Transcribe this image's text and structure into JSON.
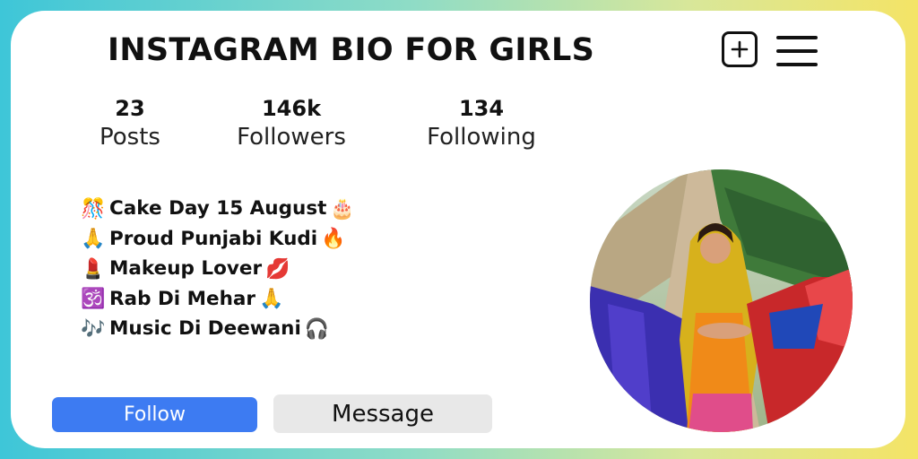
{
  "profile": {
    "title": "INSTAGRAM BIO FOR GIRLS",
    "add_icon": "plus-square-icon",
    "menu_icon": "hamburger-menu-icon"
  },
  "stats": [
    {
      "value": "23",
      "label": "Posts"
    },
    {
      "value": "146k",
      "label": "Followers"
    },
    {
      "value": "134",
      "label": "Following"
    }
  ],
  "bio": [
    {
      "lead": "🎊",
      "text": "Cake Day 15 August",
      "trail": "🎂"
    },
    {
      "lead": "🙏",
      "text": "Proud Punjabi Kudi",
      "trail": "🔥"
    },
    {
      "lead": "💄",
      "text": "Makeup Lover",
      "trail": "💋"
    },
    {
      "lead": "🕉️",
      "text": "Rab Di Mehar",
      "trail": "🙏"
    },
    {
      "lead": "🎶",
      "text": "Music Di Deewani",
      "trail": "🎧"
    }
  ],
  "buttons": {
    "follow": "Follow",
    "message": "Message"
  },
  "colors": {
    "follow_bg": "#3d7bf2",
    "message_bg": "#e8e8e8"
  }
}
